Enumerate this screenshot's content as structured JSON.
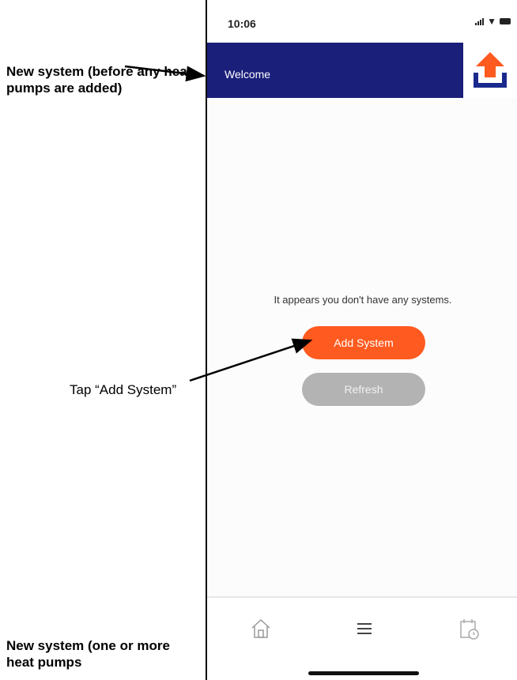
{
  "annotations": {
    "top_note": "New system (before any heat pumps are added)",
    "tap_note": "Tap “Add System”",
    "bottom_note": "New system (one or more heat pumps"
  },
  "status_bar": {
    "time": "10:06"
  },
  "header": {
    "title": "Welcome",
    "bar_color": "#1a1f7a",
    "logo_icon": "upload-arrow-icon"
  },
  "main": {
    "empty_message": "It appears you don't have any systems.",
    "add_button": "Add System",
    "refresh_button": "Refresh"
  },
  "colors": {
    "accent": "#ff5a1f",
    "disabled": "#b3b3b3",
    "logo_blue": "#1a2a8c"
  },
  "tab_bar": {
    "icons": [
      "home-icon",
      "menu-icon",
      "schedule-icon"
    ]
  }
}
